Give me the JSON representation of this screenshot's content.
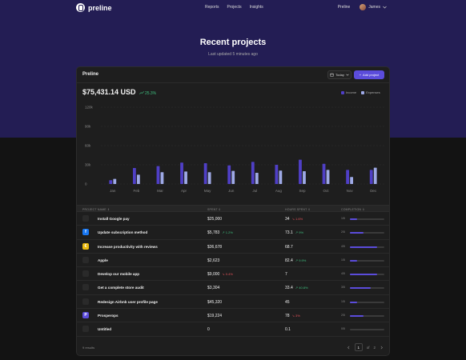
{
  "nav": {
    "brand": "preline",
    "links": [
      "Reports",
      "Projects",
      "Insights"
    ],
    "right_link": "Preline",
    "user": "James"
  },
  "hero": {
    "title": "Recent projects",
    "subtitle": "Last updated 5 minutes ago"
  },
  "card": {
    "title": "Preline",
    "date_filter": "Today",
    "add_label": "Add project",
    "total": "$75,431.14 USD",
    "total_change": "25.3%",
    "legend": [
      {
        "label": "Income",
        "color": "#4f3fc6"
      },
      {
        "label": "Expenses",
        "color": "#9ea9e6"
      }
    ]
  },
  "chart_data": {
    "type": "bar",
    "categories": [
      "Jan",
      "Feb",
      "Mar",
      "Apr",
      "May",
      "Jun",
      "Jul",
      "Aug",
      "Sep",
      "Oct",
      "Nov",
      "Dec"
    ],
    "series": [
      {
        "name": "Income",
        "values": [
          6000,
          25000,
          28000,
          33500,
          32500,
          29000,
          34500,
          30000,
          38000,
          31500,
          22000,
          22000
        ]
      },
      {
        "name": "Expenses",
        "values": [
          8000,
          14500,
          18500,
          19500,
          18500,
          20500,
          17500,
          21000,
          20000,
          22000,
          11000,
          25500
        ]
      }
    ],
    "yticks": [
      "120k",
      "90k",
      "60k",
      "30k",
      "0"
    ],
    "ylim": [
      0,
      120000
    ],
    "grid": true
  },
  "table": {
    "headers": [
      "PROJECT NAME",
      "SPENT",
      "HOURS SPENT",
      "COMPLETION"
    ],
    "rows": [
      {
        "icon": "google-pay-icon",
        "icon_char": "",
        "icon_bg": "#2a2a2a",
        "name": "Install Google pay",
        "spent": "$25,000",
        "spent_delta": "",
        "spent_dir": "",
        "hours": "34",
        "hours_delta": "1.6%",
        "hours_dir": "down",
        "comp_label": "1/5",
        "comp": 0.2
      },
      {
        "icon": "facebook-icon",
        "icon_char": "f",
        "icon_bg": "#1877f2",
        "name": "Update subscription method",
        "spent": "$5,783",
        "spent_delta": "1.2%",
        "spent_dir": "up",
        "hours": "73.1",
        "hours_delta": "9%",
        "hours_dir": "up",
        "comp_label": "2/5",
        "comp": 0.4
      },
      {
        "icon": "coin-icon",
        "icon_char": "€",
        "icon_bg": "#e9b90f",
        "name": "Increase productivity with reviews",
        "spent": "$36,678",
        "spent_delta": "",
        "spent_dir": "",
        "hours": "68.7",
        "hours_delta": "",
        "hours_dir": "",
        "comp_label": "4/5",
        "comp": 0.8
      },
      {
        "icon": "apple-icon",
        "icon_char": "",
        "icon_bg": "#2a2a2a",
        "name": "Apple",
        "spent": "$2,623",
        "spent_delta": "",
        "spent_dir": "",
        "hours": "82.4",
        "hours_delta": "9.9%",
        "hours_dir": "up",
        "comp_label": "1/5",
        "comp": 0.2
      },
      {
        "icon": "mobile-app-icon",
        "icon_char": "",
        "icon_bg": "#2a2a2a",
        "name": "Develop our mobile app",
        "spent": "$9,000",
        "spent_delta": "0.4%",
        "spent_dir": "down",
        "hours": "7",
        "hours_delta": "",
        "hours_dir": "",
        "comp_label": "4/5",
        "comp": 0.8
      },
      {
        "icon": "dropbox-icon",
        "icon_char": "",
        "icon_bg": "#2a2a2a",
        "name": "Get a complete store audit",
        "spent": "$3,304",
        "spent_delta": "",
        "spent_dir": "",
        "hours": "33.4",
        "hours_delta": "40.8%",
        "hours_dir": "up",
        "comp_label": "3/5",
        "comp": 0.6
      },
      {
        "icon": "airbnb-icon",
        "icon_char": "",
        "icon_bg": "#2a2a2a",
        "name": "Redesign Airbnb user profile page",
        "spent": "$45,320",
        "spent_delta": "",
        "spent_dir": "",
        "hours": "45",
        "hours_delta": "",
        "hours_dir": "",
        "comp_label": "1/5",
        "comp": 0.2
      },
      {
        "icon": "prosperops-icon",
        "icon_char": "P",
        "icon_bg": "#5b4cdb",
        "name": "Prosperops",
        "spent": "$19,224",
        "spent_delta": "",
        "spent_dir": "",
        "hours": "78",
        "hours_delta": "3%",
        "hours_dir": "down",
        "comp_label": "2/5",
        "comp": 0.4
      },
      {
        "icon": "untitled-icon",
        "icon_char": "",
        "icon_bg": "#2a2a2a",
        "name": "Untitled",
        "spent": "0",
        "spent_delta": "",
        "spent_dir": "",
        "hours": "0.1",
        "hours_delta": "",
        "hours_dir": "",
        "comp_label": "0/5",
        "comp": 0
      }
    ]
  },
  "footer": {
    "results": "9 results",
    "page": "1",
    "of_label": "of",
    "total_pages": "2"
  }
}
